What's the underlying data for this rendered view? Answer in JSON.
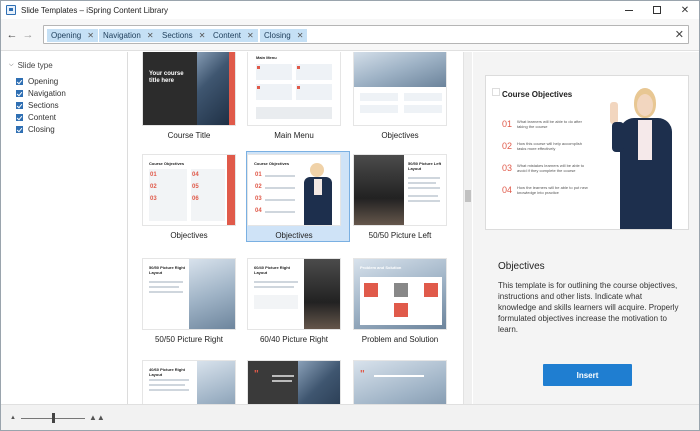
{
  "window": {
    "title": "Slide Templates – iSpring Content Library"
  },
  "search": {
    "tags": [
      "Opening",
      "Navigation",
      "Sections",
      "Content",
      "Closing"
    ]
  },
  "sidebar": {
    "group_label": "Slide type",
    "items": [
      {
        "label": "Opening",
        "checked": true
      },
      {
        "label": "Navigation",
        "checked": true
      },
      {
        "label": "Sections",
        "checked": true
      },
      {
        "label": "Content",
        "checked": true
      },
      {
        "label": "Closing",
        "checked": true
      }
    ]
  },
  "templates": [
    {
      "label": "Course Title",
      "thumb_title": "Your course title here",
      "selected": false
    },
    {
      "label": "Main Menu",
      "thumb_title": "Main Menu",
      "selected": false
    },
    {
      "label": "Objectives",
      "thumb_title": "",
      "selected": false
    },
    {
      "label": "Objectives",
      "thumb_title": "Course Objectives",
      "selected": false
    },
    {
      "label": "Objectives",
      "thumb_title": "Course Objectives",
      "selected": true
    },
    {
      "label": "50/50 Picture Left",
      "thumb_title": "50/50 Picture Left Layout",
      "selected": false
    },
    {
      "label": "50/50 Picture Right",
      "thumb_title": "50/50 Picture Right Layout",
      "selected": false
    },
    {
      "label": "60/40 Picture Right",
      "thumb_title": "60/40 Picture Right Layout",
      "selected": false
    },
    {
      "label": "Problem and Solution",
      "thumb_title": "Problem and Solution",
      "selected": false
    },
    {
      "label": "",
      "thumb_title": "40/60 Picture Right Layout",
      "selected": false
    },
    {
      "label": "",
      "thumb_title": "",
      "selected": false
    },
    {
      "label": "",
      "thumb_title": "",
      "selected": false
    }
  ],
  "preview": {
    "slide_title": "Course Objectives",
    "points": [
      {
        "num": "01",
        "text": "What learners will be able to do after taking the course"
      },
      {
        "num": "02",
        "text": "How this course will help accomplish tasks more effectively"
      },
      {
        "num": "03",
        "text": "What mistakes learners will be able to avoid if they complete the course"
      },
      {
        "num": "04",
        "text": "How the learners will be able to put new knowledge into practice"
      }
    ],
    "name": "Objectives",
    "description": "This template is for outlining the course objectives, instructions and other lists. Indicate what knowledge and skills learners will acquire. Properly formulated objectives increase the motivation to learn.",
    "insert_label": "Insert"
  },
  "zoom": {
    "level": 0.5
  },
  "colors": {
    "accent": "#1f7ed1",
    "tag_bg": "#c5e0f5",
    "number_red": "#e05a4a",
    "selection": "#cfe3f7"
  }
}
